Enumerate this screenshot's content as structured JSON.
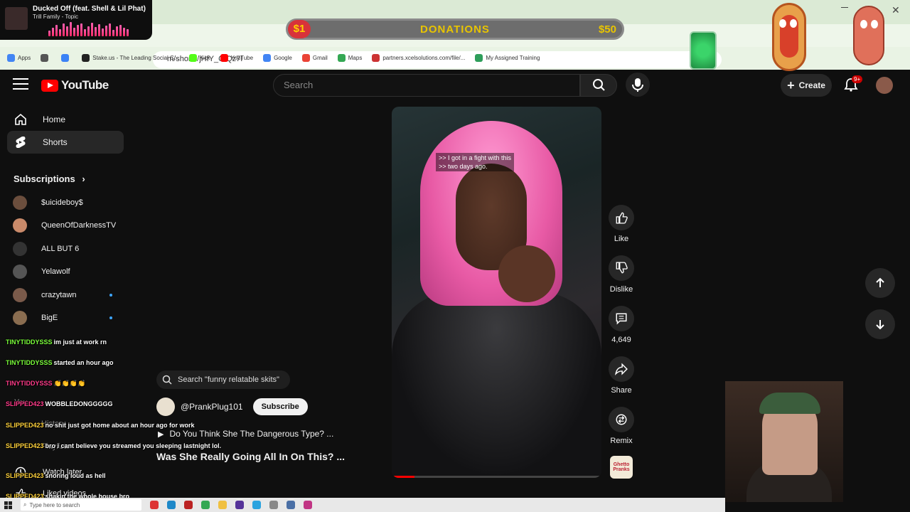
{
  "now_playing": {
    "title": "Ducked Off (feat. Shell & Lil Phat)",
    "artist": "Trill Family - Topic"
  },
  "browser": {
    "url": "m/shorts/jHfY_CIQz7I",
    "bookmarks": [
      {
        "label": "Apps",
        "color": "#4285f4"
      },
      {
        "label": "",
        "color": "#555555"
      },
      {
        "label": "",
        "color": "#3b82f6"
      },
      {
        "label": "Stake.us - The Leading Social C...",
        "color": "#222222"
      },
      {
        "label": "Kick",
        "color": "#53fc18"
      },
      {
        "label": "YouTube",
        "color": "#ff0000"
      },
      {
        "label": "Google",
        "color": "#4285f4"
      },
      {
        "label": "Gmail",
        "color": "#ea4335"
      },
      {
        "label": "Maps",
        "color": "#34a853"
      },
      {
        "label": "partners.xcelsolutions.com/file/...",
        "color": "#c33"
      },
      {
        "label": "My Assigned Training",
        "color": "#2e9e5a"
      }
    ]
  },
  "donations": {
    "min": "$1",
    "label": "DONATIONS",
    "max": "$50"
  },
  "header": {
    "logo": "YouTube",
    "search_placeholder": "Search",
    "create_label": "Create",
    "notif_count": "9+"
  },
  "sidebar": {
    "home": "Home",
    "shorts": "Shorts",
    "subscriptions_title": "Subscriptions",
    "subscriptions": [
      {
        "name": "$uicideboy$",
        "color": "#6b4e3d",
        "dot": false
      },
      {
        "name": "QueenOfDarknessTV",
        "color": "#c98a6a",
        "dot": false
      },
      {
        "name": "ALL BUT 6",
        "color": "#333333",
        "dot": false
      },
      {
        "name": "Yelawolf",
        "color": "#555555",
        "dot": false
      },
      {
        "name": "crazytawn",
        "color": "#7a5a4a",
        "dot": true
      },
      {
        "name": "BigE",
        "color": "#8a6d50",
        "dot": true
      }
    ],
    "you": "You",
    "history": "History",
    "playlists": "Playlists",
    "watch_later": "Watch later",
    "liked_videos": "Liked videos"
  },
  "chat": [
    {
      "name": "TINYTIDDYSSS",
      "color": "#7cff3c",
      "text": "im just at work rn"
    },
    {
      "name": "TINYTIDDYSSS",
      "color": "#7cff3c",
      "text": "started an hour ago"
    },
    {
      "name": "TINYTIDDYSSS",
      "color": "#ff3c8a",
      "text": "👏👏👏👏"
    },
    {
      "name": "SLIPPED423",
      "color": "#ff3c8a",
      "text": "WOBBLEDONGGGGG"
    },
    {
      "name": "SLIPPED423",
      "color": "#ffd23c",
      "text": "no shit just got home about an hour ago for work"
    },
    {
      "name": "SLIPPED423",
      "color": "#ffd23c",
      "text": "bro i cant believe you streamed you sleeping lastnight lol."
    },
    {
      "name": "SLIPPED423",
      "color": "#ffd23c",
      "text": "snoring loud as hell"
    },
    {
      "name": "SLIPPED423",
      "color": "#ffd23c",
      "text": "shakin the whole house bro"
    }
  ],
  "short": {
    "search_chip": "Search \"funny relatable skits\"",
    "channel": "@PrankPlug101",
    "subscribe": "Subscribe",
    "linked_video": "Do You Think She The Dangerous Type? ...",
    "title": "Was She Really Going All In On This? ...",
    "caption_line1": ">> I got in a fight with this",
    "caption_line2": ">> two days ago.",
    "progress": 0.11,
    "channel_thumb": "Ghetto Pranks"
  },
  "actions": {
    "like": "Like",
    "dislike": "Dislike",
    "comments": "4,649",
    "share": "Share",
    "remix": "Remix"
  },
  "taskbar": {
    "search_placeholder": "Type here to search"
  }
}
